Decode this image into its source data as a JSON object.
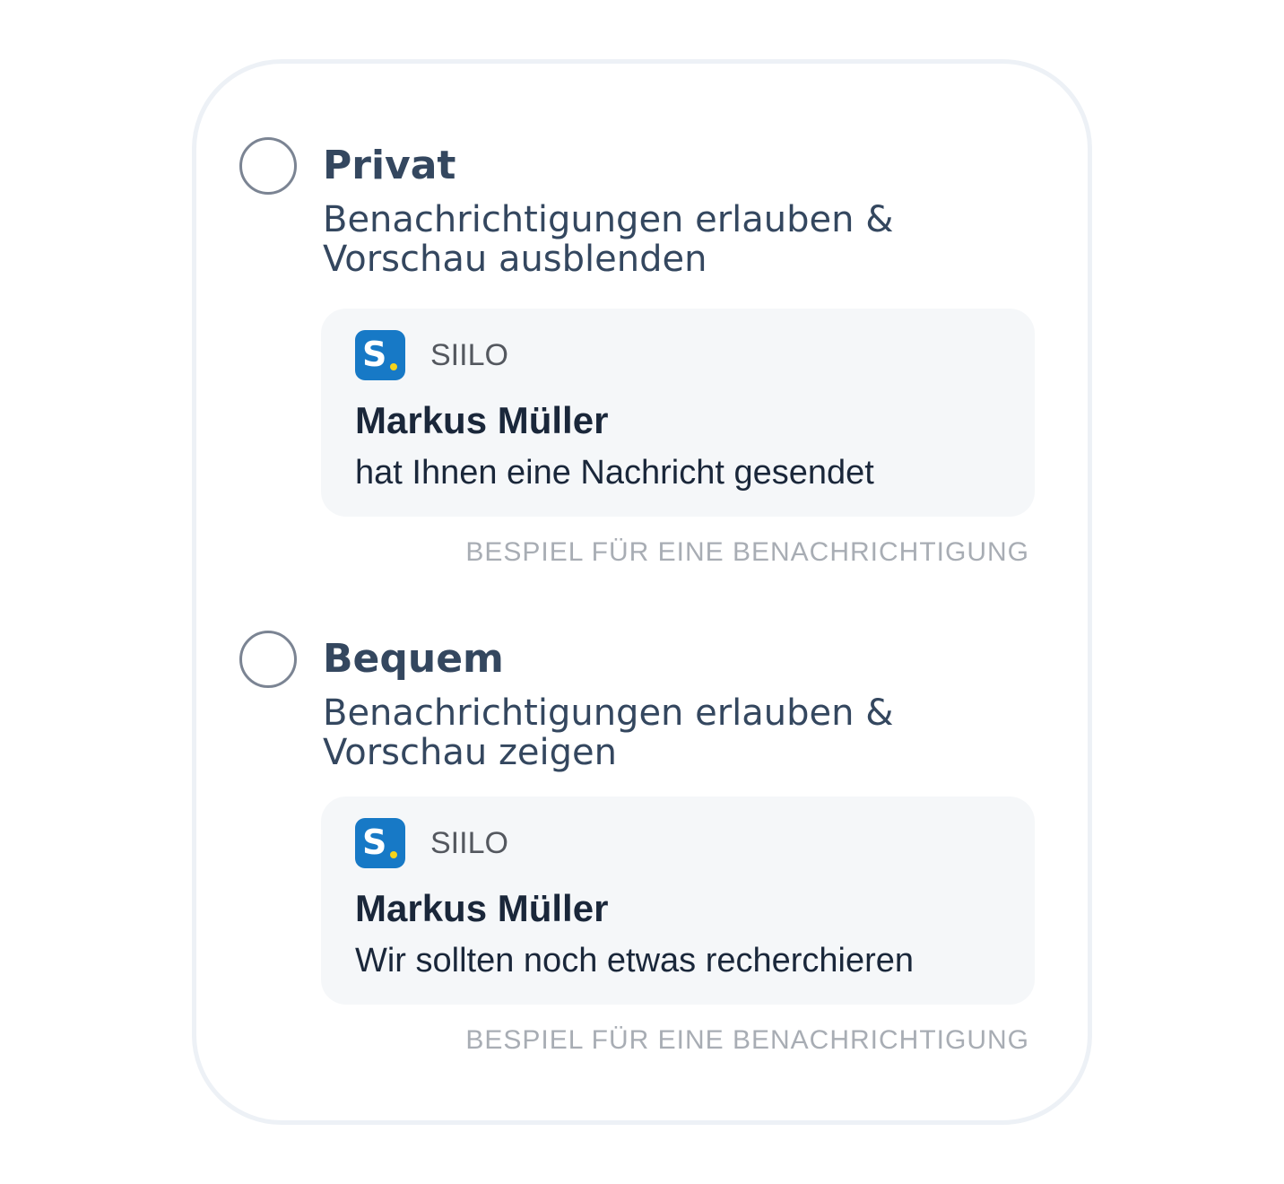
{
  "options": [
    {
      "title": "Privat",
      "description_line1": "Benachrichtigungen erlauben &",
      "description_line2": "Vorschau ausblenden",
      "notification": {
        "app_icon_letter": "S",
        "app_name": "SIILO",
        "sender": "Markus Müller",
        "message": "hat Ihnen eine Nachricht gesendet"
      },
      "caption": "BESPIEL FÜR EINE BENACHRICHTIGUNG"
    },
    {
      "title": "Bequem",
      "description_line1": "Benachrichtigungen erlauben &",
      "description_line2": "Vorschau zeigen",
      "notification": {
        "app_icon_letter": "S",
        "app_name": "SIILO",
        "sender": "Markus Müller",
        "message": "Wir sollten noch etwas recherchieren"
      },
      "caption": "BESPIEL FÜR EINE BENACHRICHTIGUNG"
    }
  ],
  "colors": {
    "title": "#34475f",
    "app_icon_bg": "#1779c6",
    "app_icon_dot": "#f6d31b",
    "notification_bg": "#f5f7f9",
    "caption": "#a8adb4",
    "card_border": "#edf1f6"
  },
  "icons": {
    "radio": "radio-unselected-icon",
    "app": "siilo-app-icon"
  }
}
